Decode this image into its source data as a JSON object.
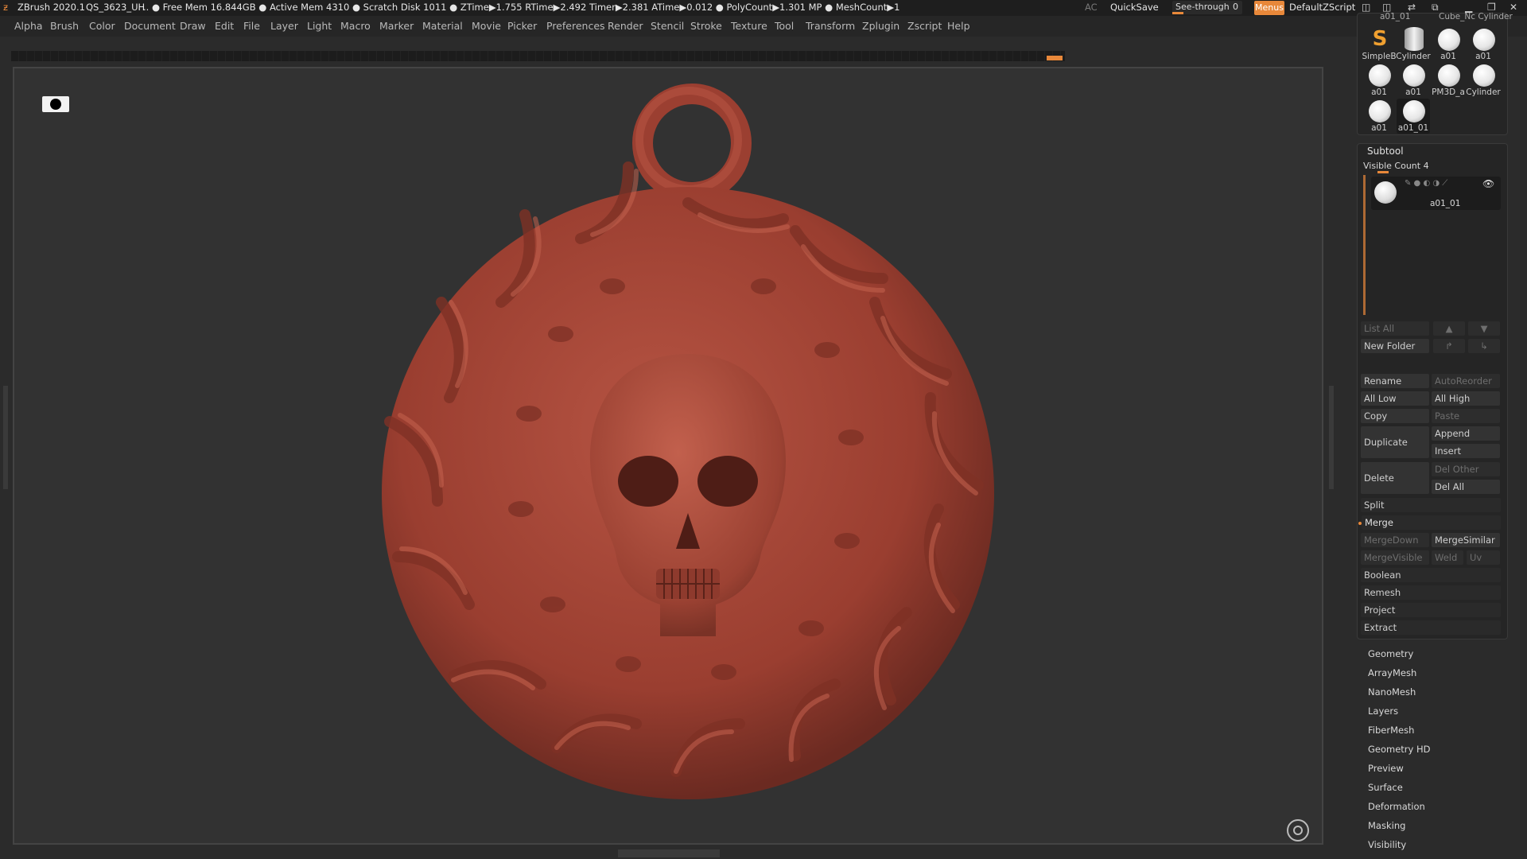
{
  "titlebar": {
    "app": "ZBrush 2020.1",
    "file": "QS_3623_UH",
    "stats": "..  ● Free Mem 16.844GB ● Active Mem 4310 ● Scratch Disk 1011 ●  ZTime▶1.755 RTime▶2.492 Timer▶2.381 ATime▶0.012 ● PolyCount▶1.301 MP  ● MeshCount▶1",
    "ac": "AC",
    "quicksave": "QuickSave",
    "seethrough_label": "See-through",
    "seethrough_value": "0",
    "menus": "Menus",
    "script": "DefaultZScript"
  },
  "menu": [
    "Alpha",
    "Brush",
    "Color",
    "Document",
    "Draw",
    "Edit",
    "File",
    "Layer",
    "Light",
    "Macro",
    "Marker",
    "Material",
    "Movie",
    "Picker",
    "Preferences",
    "Render",
    "Stencil",
    "Stroke",
    "Texture",
    "Tool",
    "Transform",
    "Zplugin",
    "Zscript",
    "Help"
  ],
  "tools": {
    "top_labels": [
      "a01_01",
      "Cube_Nc Cylinder"
    ],
    "items": [
      {
        "label": "SimpleB",
        "icon": "simplebrush-icon"
      },
      {
        "label": "Cylinder",
        "icon": "cylinder-icon"
      },
      {
        "label": "a01",
        "icon": "sphere-icon"
      },
      {
        "label": "a01",
        "icon": "sphere-icon"
      },
      {
        "label": "a01",
        "icon": "sphere-icon"
      },
      {
        "label": "a01",
        "icon": "sphere-icon"
      },
      {
        "label": "PM3D_a",
        "icon": "sphere-icon"
      },
      {
        "label": "Cylinder",
        "icon": "sphere-icon"
      },
      {
        "label": "a01",
        "icon": "sphere-icon"
      },
      {
        "label": "a01_01",
        "icon": "sphere-icon"
      }
    ]
  },
  "subtool": {
    "title": "Subtool",
    "visible_count": "Visible Count 4",
    "item_name": "a01_01",
    "list_all": "List All",
    "new_folder": "New Folder",
    "rename": "Rename",
    "autoreorder": "AutoReorder",
    "all_low": "All Low",
    "all_high": "All High",
    "copy": "Copy",
    "paste": "Paste",
    "duplicate": "Duplicate",
    "append": "Append",
    "insert": "Insert",
    "delete": "Delete",
    "del_other": "Del Other",
    "del_all": "Del All",
    "split": "Split",
    "merge": "Merge",
    "mergedown": "MergeDown",
    "mergesimilar": "MergeSimilar",
    "mergevisible": "MergeVisible",
    "weld": "Weld",
    "uv": "Uv",
    "boolean": "Boolean",
    "remesh": "Remesh",
    "project": "Project",
    "extract": "Extract"
  },
  "sections": [
    "Geometry",
    "ArrayMesh",
    "NanoMesh",
    "Layers",
    "FiberMesh",
    "Geometry HD",
    "Preview",
    "Surface",
    "Deformation",
    "Masking",
    "Visibility"
  ],
  "colors": {
    "accent": "#e8883a",
    "model": "#a84536"
  }
}
